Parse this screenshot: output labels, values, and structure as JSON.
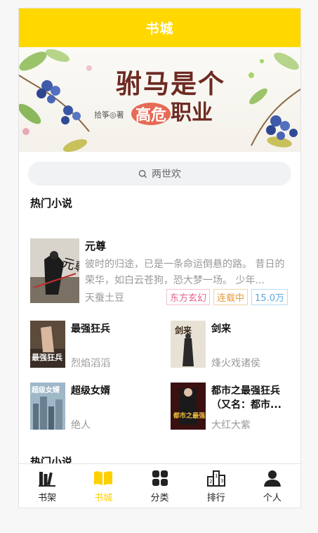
{
  "header": {
    "title": "书城"
  },
  "banner": {
    "title_line1": "驸马是个",
    "title_highlight": "高危",
    "title_line2": "职业",
    "author": "拾筝◎著"
  },
  "search": {
    "placeholder": "两世欢"
  },
  "hot_section": {
    "title": "热门小说"
  },
  "featured": {
    "title": "元尊",
    "description": "彼时的归途，已是一条命运倒悬的路。 昔日的荣华，如白云苍狗，恐大梦一场。 少年...",
    "author": "天蚕土豆",
    "tags": [
      "东方玄幻",
      "连载中",
      "15.0万"
    ],
    "cover_text": "元尊"
  },
  "books": [
    {
      "title": "最强狂兵",
      "author": "烈焰滔滔",
      "cover_text": "最强狂兵"
    },
    {
      "title": "剑来",
      "author": "烽火戏诸侯",
      "cover_text": "剑来"
    },
    {
      "title": "超级女婿",
      "author": "绝人",
      "cover_text": "超级女婿"
    },
    {
      "title": "都市之最强狂兵（又名：都市...",
      "author": "大红大紫",
      "cover_text": "都市之最强狂兵"
    }
  ],
  "hot_section_2": {
    "title": "热门小说"
  },
  "tabs": [
    {
      "label": "书架",
      "icon": "bookshelf-icon"
    },
    {
      "label": "书城",
      "icon": "book-open-icon",
      "active": true
    },
    {
      "label": "分类",
      "icon": "category-grid-icon"
    },
    {
      "label": "排行",
      "icon": "ranking-podium-icon"
    },
    {
      "label": "个人",
      "icon": "user-icon"
    }
  ],
  "colors": {
    "accent": "#ffd800",
    "tab_active": "#ffd000"
  }
}
